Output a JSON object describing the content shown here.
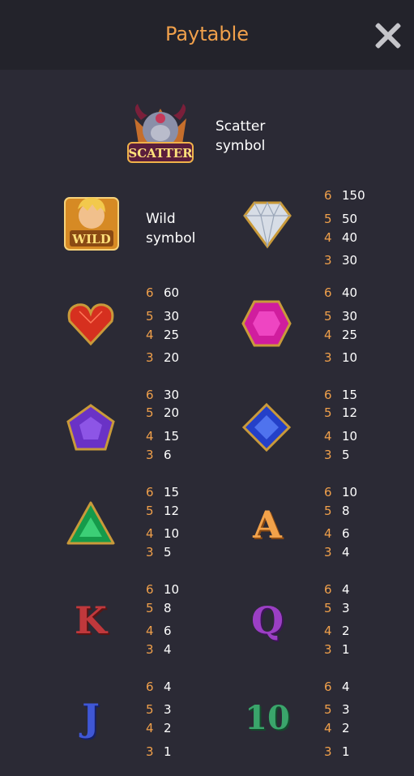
{
  "header": {
    "title": "Paytable"
  },
  "scatter": {
    "badge": "SCATTER",
    "label_line1": "Scatter",
    "label_line2": "symbol"
  },
  "wild": {
    "badge": "WILD",
    "label_line1": "Wild",
    "label_line2": "symbol"
  },
  "symbols": [
    {
      "name": "diamond",
      "pays": [
        {
          "count": "6",
          "value": "150"
        },
        {
          "count": "5",
          "value": "50"
        },
        {
          "count": "4",
          "value": "40"
        },
        {
          "count": "3",
          "value": "30"
        }
      ]
    },
    {
      "name": "red-heart-gem",
      "pays": [
        {
          "count": "6",
          "value": "60"
        },
        {
          "count": "5",
          "value": "30"
        },
        {
          "count": "4",
          "value": "25"
        },
        {
          "count": "3",
          "value": "20"
        }
      ]
    },
    {
      "name": "pink-hexagon-gem",
      "pays": [
        {
          "count": "6",
          "value": "40"
        },
        {
          "count": "5",
          "value": "30"
        },
        {
          "count": "4",
          "value": "25"
        },
        {
          "count": "3",
          "value": "10"
        }
      ]
    },
    {
      "name": "purple-pentagon-gem",
      "pays": [
        {
          "count": "6",
          "value": "30"
        },
        {
          "count": "5",
          "value": "20"
        },
        {
          "count": "4",
          "value": "15"
        },
        {
          "count": "3",
          "value": "6"
        }
      ]
    },
    {
      "name": "blue-square-gem",
      "pays": [
        {
          "count": "6",
          "value": "15"
        },
        {
          "count": "5",
          "value": "12"
        },
        {
          "count": "4",
          "value": "10"
        },
        {
          "count": "3",
          "value": "5"
        }
      ]
    },
    {
      "name": "green-triangle-gem",
      "pays": [
        {
          "count": "6",
          "value": "15"
        },
        {
          "count": "5",
          "value": "12"
        },
        {
          "count": "4",
          "value": "10"
        },
        {
          "count": "3",
          "value": "5"
        }
      ]
    },
    {
      "name": "letter-a",
      "glyph": "A",
      "color": "#f2a24a",
      "pays": [
        {
          "count": "6",
          "value": "10"
        },
        {
          "count": "5",
          "value": "8"
        },
        {
          "count": "4",
          "value": "6"
        },
        {
          "count": "3",
          "value": "4"
        }
      ]
    },
    {
      "name": "letter-k",
      "glyph": "K",
      "color": "#c0383c",
      "pays": [
        {
          "count": "6",
          "value": "10"
        },
        {
          "count": "5",
          "value": "8"
        },
        {
          "count": "4",
          "value": "6"
        },
        {
          "count": "3",
          "value": "4"
        }
      ]
    },
    {
      "name": "letter-q",
      "glyph": "Q",
      "color": "#9b3fc4",
      "pays": [
        {
          "count": "6",
          "value": "4"
        },
        {
          "count": "5",
          "value": "3"
        },
        {
          "count": "4",
          "value": "2"
        },
        {
          "count": "3",
          "value": "1"
        }
      ]
    },
    {
      "name": "letter-j",
      "glyph": "J",
      "color": "#3f57d6",
      "pays": [
        {
          "count": "6",
          "value": "4"
        },
        {
          "count": "5",
          "value": "3"
        },
        {
          "count": "4",
          "value": "2"
        },
        {
          "count": "3",
          "value": "1"
        }
      ]
    },
    {
      "name": "number-10",
      "glyph": "10",
      "color": "#3aa56b",
      "pays": [
        {
          "count": "6",
          "value": "4"
        },
        {
          "count": "5",
          "value": "3"
        },
        {
          "count": "4",
          "value": "2"
        },
        {
          "count": "3",
          "value": "1"
        }
      ]
    }
  ]
}
